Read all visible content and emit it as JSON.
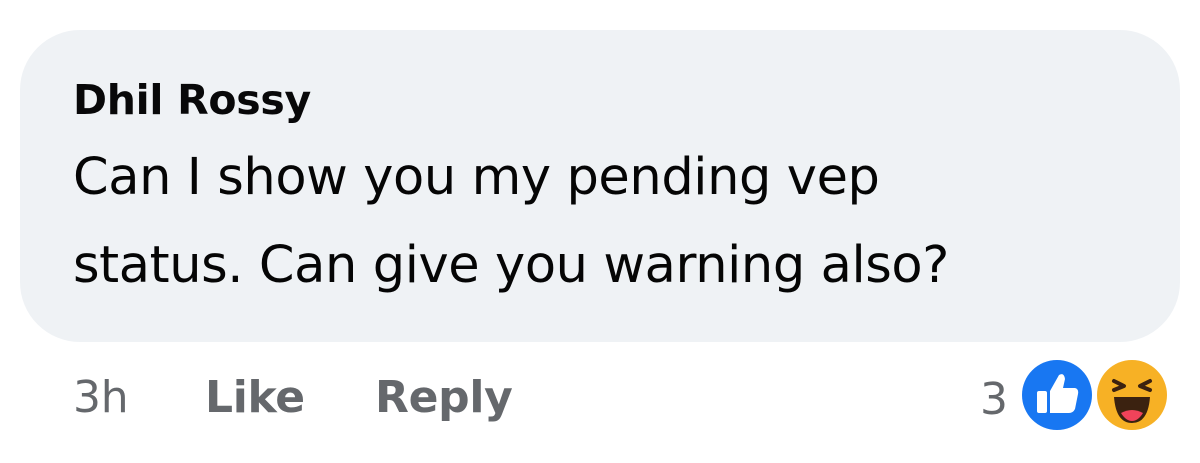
{
  "comment": {
    "author": "Dhil Rossy",
    "text_lines": [
      "Can I show you my pending vep",
      "status. Can give you warning also?"
    ]
  },
  "actions": {
    "time": "3h",
    "like": "Like",
    "reply": "Reply"
  },
  "reactions": {
    "count": "3",
    "icons": [
      "like-icon",
      "haha-icon"
    ]
  },
  "colors": {
    "bubble": "#eff2f5",
    "like_blue": "#1877f2",
    "haha_yellow": "#f7b125",
    "muted_text": "#65686c"
  }
}
